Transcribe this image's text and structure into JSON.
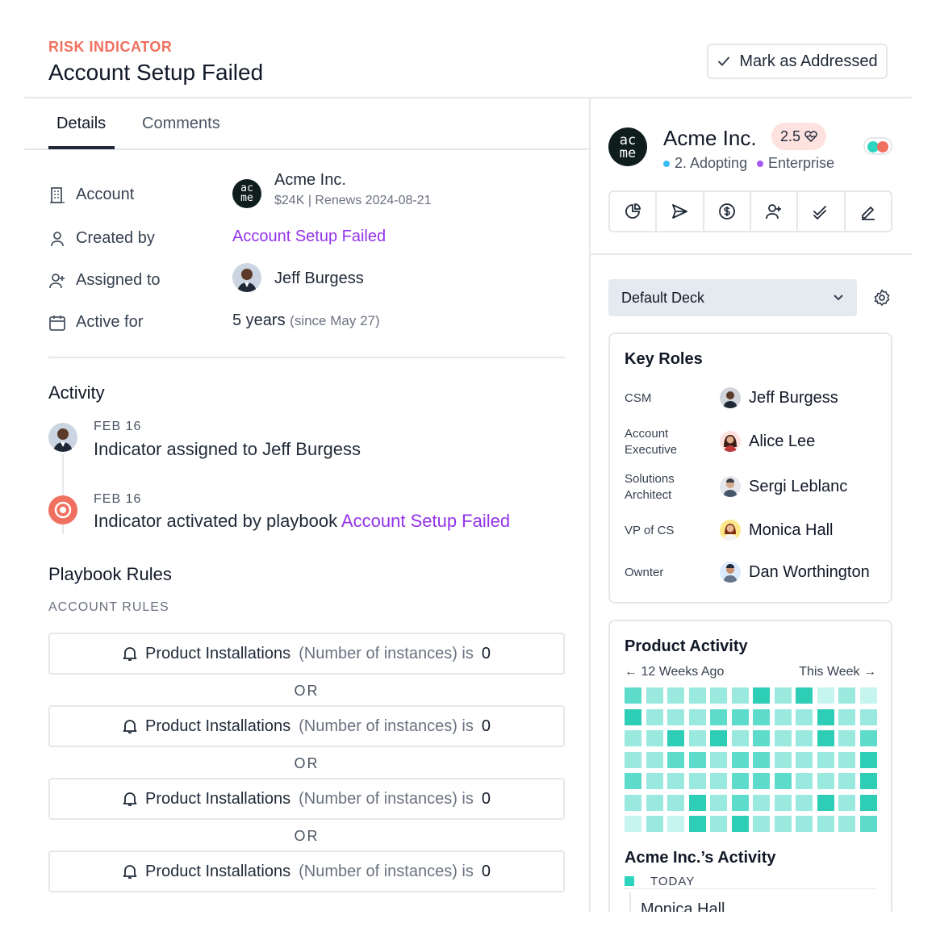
{
  "header": {
    "eyebrow": "RISK INDICATOR",
    "title": "Account Setup Failed",
    "mark_button": "Mark as Addressed",
    "mark_icon": "check-icon"
  },
  "tabs": [
    {
      "label": "Details",
      "active": true
    },
    {
      "label": "Comments",
      "active": false
    }
  ],
  "details": {
    "account": {
      "label": "Account",
      "icon": "building-icon",
      "name": "Acme Inc.",
      "sub": "$24K | Renews 2024-08-21",
      "avatar_text": [
        "ac",
        "me"
      ]
    },
    "created_by": {
      "label": "Created by",
      "icon": "user-icon",
      "value": "Account Setup Failed"
    },
    "assigned_to": {
      "label": "Assigned to",
      "icon": "user-plus-icon",
      "value": "Jeff Burgess"
    },
    "active_for": {
      "label": "Active for",
      "icon": "calendar-icon",
      "value": "5 years",
      "since": "(since May 27)"
    }
  },
  "activity": {
    "title": "Activity",
    "items": [
      {
        "date": "FEB 16",
        "text": "Indicator assigned to Jeff Burgess",
        "link": ""
      },
      {
        "date": "FEB 16",
        "text": "Indicator activated by playbook ",
        "link": "Account Setup Failed"
      }
    ]
  },
  "playbook": {
    "title": "Playbook Rules",
    "subhead": "ACCOUNT RULES",
    "or_label": "OR",
    "rules": [
      {
        "name": "Product Installations",
        "condition": "(Number of instances) is",
        "value": "0"
      },
      {
        "name": "Product Installations",
        "condition": "(Number of instances) is",
        "value": "0"
      },
      {
        "name": "Product Installations",
        "condition": "(Number of instances) is",
        "value": "0"
      },
      {
        "name": "Product Installations",
        "condition": "(Number of instances) is",
        "value": "0"
      }
    ]
  },
  "company": {
    "name": "Acme Inc.",
    "score": "2.5",
    "stage": "2. Adopting",
    "segment": "Enterprise",
    "avatar_text": [
      "ac",
      "me"
    ],
    "colors": {
      "stage": "#38bdf8",
      "segment": "#a855f7",
      "accent": "#9333ea",
      "risk": "#f0705f",
      "teal": "#2dd4bf"
    }
  },
  "toolbar": [
    "pie-chart-icon",
    "send-icon",
    "dollar-icon",
    "user-plus-icon",
    "check-double-icon",
    "edit-icon"
  ],
  "deck": {
    "selected": "Default Deck"
  },
  "key_roles": {
    "title": "Key Roles",
    "roles": [
      {
        "role": "CSM",
        "person": "Jeff Burgess"
      },
      {
        "role": "Account Executive",
        "person": "Alice Lee"
      },
      {
        "role": "Solutions Architect",
        "person": "Sergi Leblanc"
      },
      {
        "role": "VP of CS",
        "person": "Monica Hall"
      },
      {
        "role": "Ownter",
        "person": "Dan Worthington"
      }
    ]
  },
  "product_activity": {
    "title": "Product Activity",
    "start_label": "12 Weeks Ago",
    "end_label": "This Week",
    "levels": [
      [
        3,
        2,
        2,
        2,
        2,
        2,
        4,
        2,
        4,
        1,
        2,
        1
      ],
      [
        4,
        2,
        2,
        2,
        3,
        3,
        3,
        2,
        2,
        4,
        2,
        2
      ],
      [
        2,
        2,
        4,
        2,
        4,
        2,
        3,
        2,
        2,
        4,
        2,
        3
      ],
      [
        2,
        2,
        3,
        3,
        2,
        3,
        3,
        2,
        2,
        2,
        2,
        4
      ],
      [
        3,
        2,
        2,
        2,
        2,
        3,
        3,
        3,
        2,
        2,
        2,
        4
      ],
      [
        2,
        2,
        2,
        4,
        2,
        3,
        2,
        2,
        2,
        4,
        2,
        4
      ],
      [
        1,
        2,
        1,
        4,
        2,
        4,
        2,
        2,
        2,
        2,
        2,
        3
      ]
    ]
  },
  "company_activity": {
    "title": "Acme Inc.’s Activity",
    "today": "TODAY",
    "first_name": "Monica Hall"
  }
}
